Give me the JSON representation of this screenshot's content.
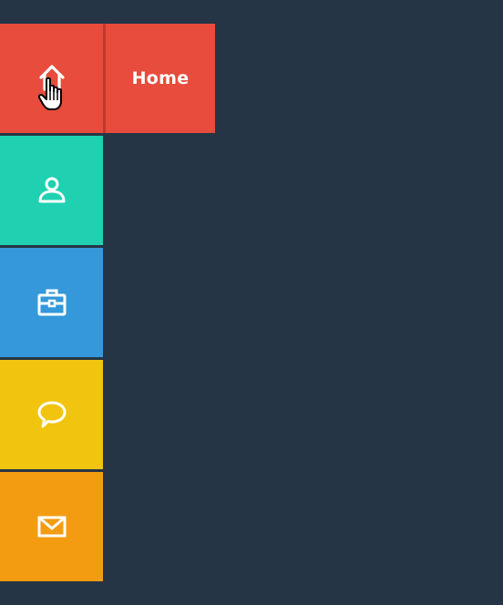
{
  "menu": {
    "items": [
      {
        "id": "home",
        "icon": "home-icon",
        "color": "#e74c3c",
        "active": true
      },
      {
        "id": "profile",
        "icon": "user-icon",
        "color": "#1fd1b1"
      },
      {
        "id": "portfolio",
        "icon": "briefcase-icon",
        "color": "#3498db"
      },
      {
        "id": "chat",
        "icon": "speech-bubble-icon",
        "color": "#f1c40f"
      },
      {
        "id": "mail",
        "icon": "envelope-icon",
        "color": "#f39c12"
      }
    ],
    "flyout": {
      "label": "Home",
      "color": "#e74c3c"
    }
  },
  "page": {
    "background": "#263545"
  }
}
